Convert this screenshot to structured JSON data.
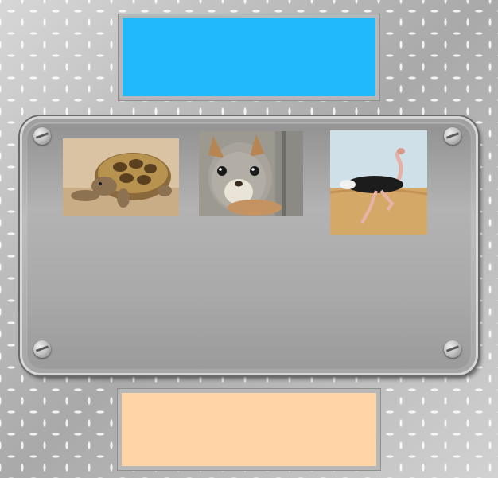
{
  "top_panel": {
    "color": "#21b9fb"
  },
  "bottom_panel": {
    "color": "#ffd5a8"
  },
  "animals": [
    {
      "name": "tortoise-image"
    },
    {
      "name": "squirrel-image"
    },
    {
      "name": "ostrich-image"
    }
  ]
}
